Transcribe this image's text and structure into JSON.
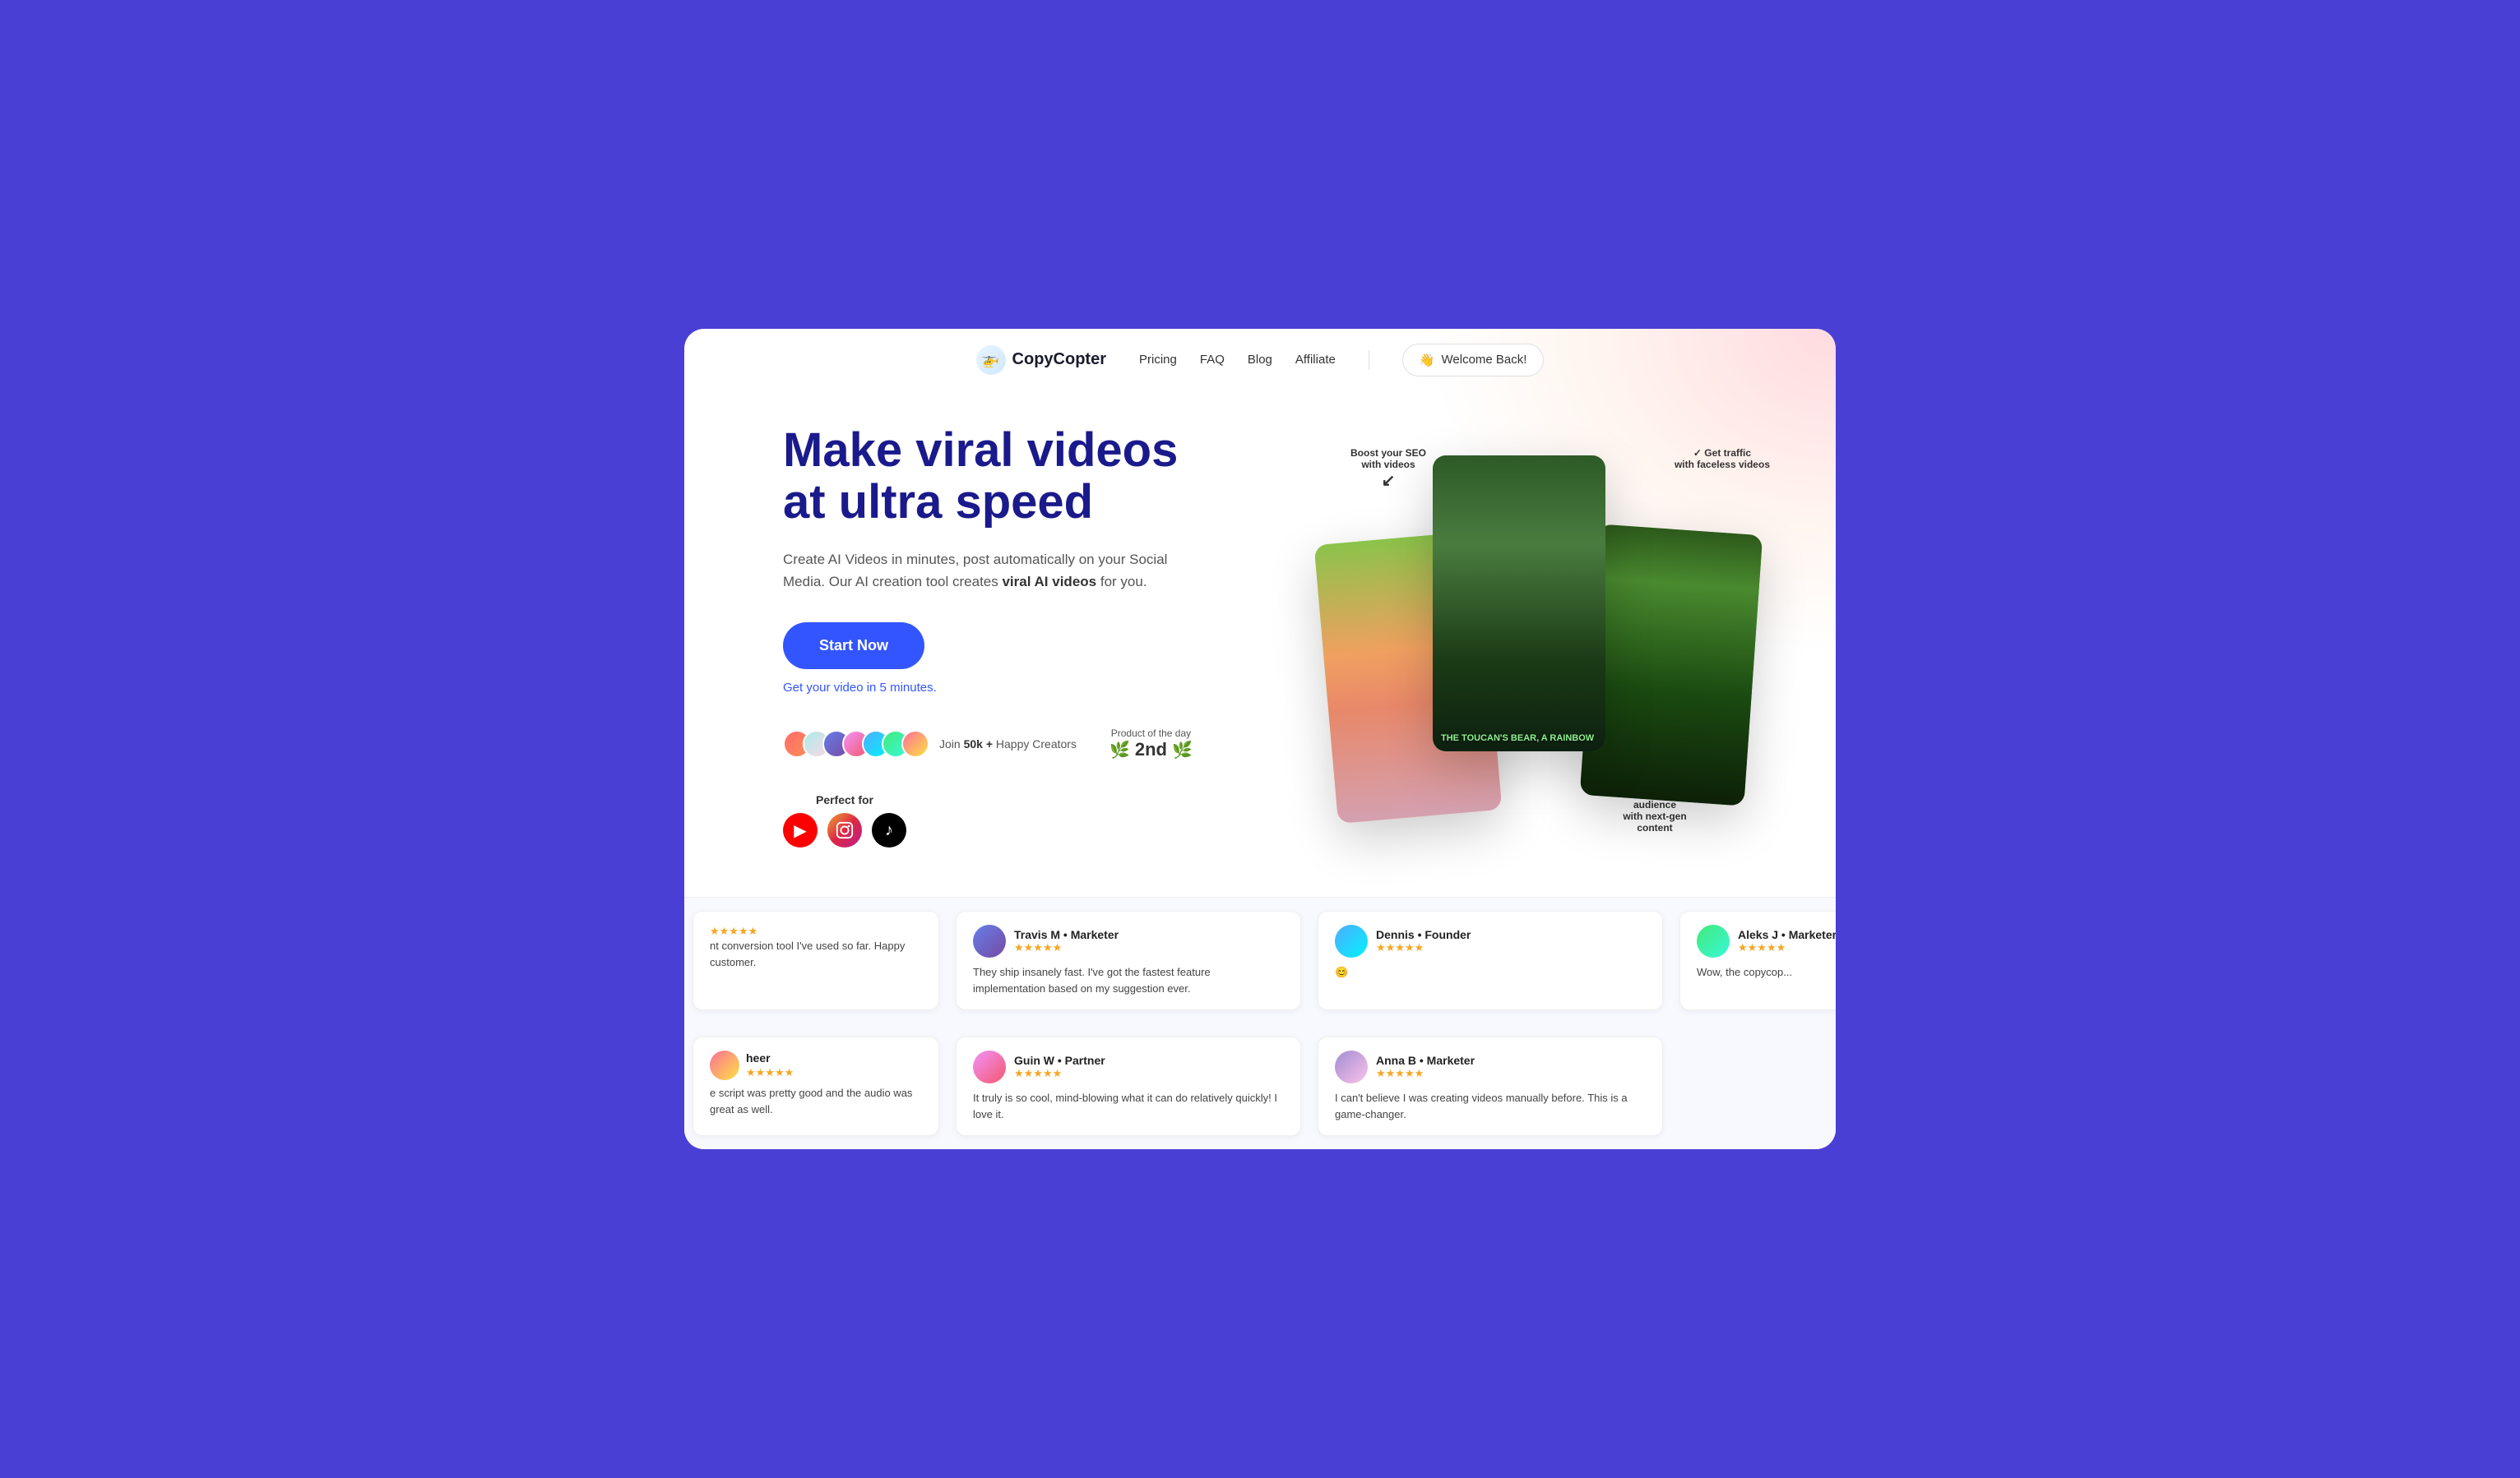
{
  "nav": {
    "logo_text": "CopyCopter",
    "logo_icon": "🚁",
    "links": [
      "Pricing",
      "FAQ",
      "Blog",
      "Affiliate"
    ],
    "cta_label": "Welcome Back!",
    "cta_icon": "👋"
  },
  "hero": {
    "title_line1": "Make viral videos",
    "title_line2": "at ultra speed",
    "subtitle_plain": "Create AI Videos in minutes, post automatically on your Social Media. Our AI creation tool creates ",
    "subtitle_bold": "viral AI videos",
    "subtitle_end": " for you.",
    "cta_button": "Start Now",
    "sub_link": "Get your video in 5 minutes.",
    "social_proof": {
      "join_text": "Join ",
      "join_count": "50k +",
      "join_suffix": " Happy Creators",
      "pod_label": "Product of the day",
      "pod_rank": "2nd",
      "perfect_for": "Perfect for"
    }
  },
  "video_cards": {
    "annotations": [
      {
        "text": "Boost your SEO with videos",
        "position": "top-left"
      },
      {
        "text": "Get traffic with faceless videos",
        "position": "top-right"
      },
      {
        "text": "Engage your audience with next-gen content",
        "position": "bottom"
      }
    ],
    "card1_text": "",
    "card2_text": "THE TOUCAN'S BEAR, A RAINBOW",
    "card3_text": ""
  },
  "reviews": {
    "row1": [
      {
        "name": "Travis M • Marketer",
        "stars": "★★★★★",
        "text": "They ship insanely fast. I've got the fastest feature implementation based on my suggestion ever."
      },
      {
        "name": "Dennis • Founder",
        "stars": "★★★★★",
        "text": "😊"
      },
      {
        "name": "Aleks J • Marketer",
        "stars": "★★★★★",
        "text": "Wow, the copycop..."
      }
    ],
    "row1_partial_left": {
      "stars": "★★★★★",
      "text": "nt conversion tool I've used so far. Happy customer."
    },
    "row2": [
      {
        "name": "Guin W • Partner",
        "stars": "★★★★★",
        "text": "It truly is so cool, mind-blowing what it can do relatively quickly! I love it."
      },
      {
        "name": "Anna B • Marketer",
        "stars": "★★★★★",
        "text": "I can't believe I was creating videos manually before. This is a game-changer."
      }
    ],
    "row2_partial_left": {
      "name": "heer",
      "stars": "★★★★★",
      "text": "e script was pretty good and the audio was great as well."
    }
  }
}
